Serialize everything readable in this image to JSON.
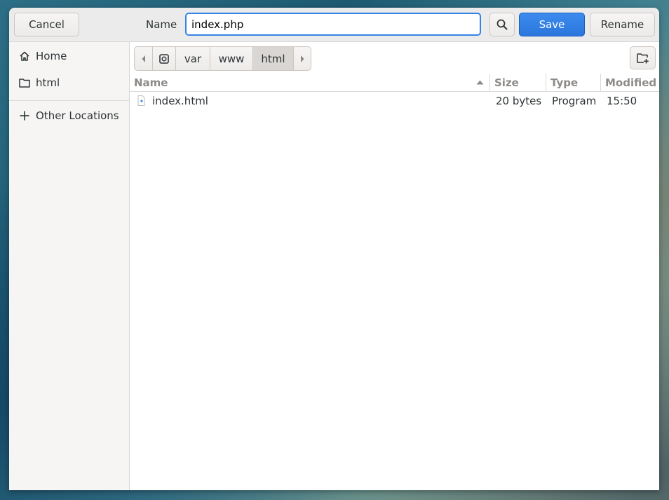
{
  "header": {
    "cancel_label": "Cancel",
    "name_label": "Name",
    "name_value": "index.php",
    "save_label": "Save",
    "rename_label": "Rename"
  },
  "sidebar": {
    "items": [
      {
        "label": "Home",
        "icon": "home-icon"
      },
      {
        "label": "html",
        "icon": "folder-icon"
      },
      {
        "label": "Other Locations",
        "icon": "plus-icon"
      }
    ]
  },
  "pathbar": {
    "segments": [
      "var",
      "www",
      "html"
    ],
    "active": "html"
  },
  "columns": {
    "name": "Name",
    "size": "Size",
    "type": "Type",
    "modified": "Modified",
    "sort": "ascending"
  },
  "files": [
    {
      "name": "index.html",
      "size": "20 bytes",
      "type": "Program",
      "modified": "15:50"
    }
  ],
  "colors": {
    "accent": "#3584e4",
    "save_button": "#2a76dd"
  }
}
